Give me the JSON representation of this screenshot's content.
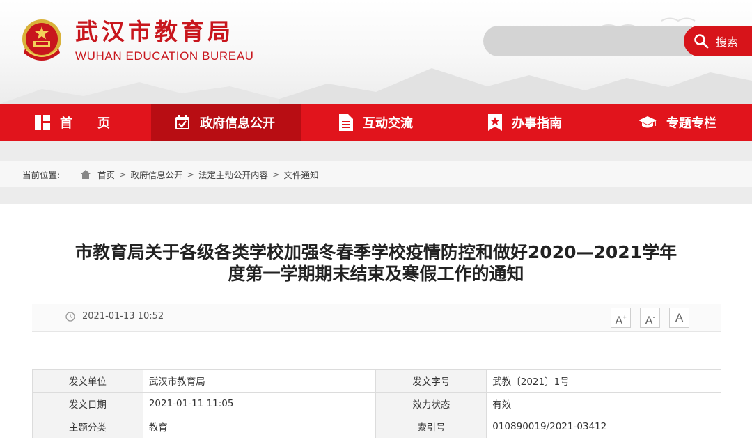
{
  "site": {
    "title": "武汉市教育局",
    "subtitle": "WUHAN EDUCATION BUREAU"
  },
  "search": {
    "placeholder": "",
    "button_label": "搜索"
  },
  "nav": [
    {
      "label": "首　　页",
      "icon": "home-grid-icon",
      "active": false
    },
    {
      "label": "政府信息公开",
      "icon": "calendar-check-icon",
      "active": true
    },
    {
      "label": "互动交流",
      "icon": "document-icon",
      "active": false
    },
    {
      "label": "办事指南",
      "icon": "bookmark-star-icon",
      "active": false
    },
    {
      "label": "专题专栏",
      "icon": "graduation-cap-icon",
      "active": false
    }
  ],
  "breadcrumb": {
    "label": "当前位置:",
    "items": [
      "首页",
      "政府信息公开",
      "法定主动公开内容",
      "文件通知"
    ],
    "separator": ">"
  },
  "article": {
    "title_line1": "市教育局关于各级各类学校加强冬春季学校疫情防控和做好2020—2021学年",
    "title_line2": "度第一学期期末结束及寒假工作的通知",
    "date": "2021-01-13 10:52",
    "font_buttons": [
      "A+",
      "A-",
      "A"
    ]
  },
  "info_table": [
    {
      "k1": "发文单位",
      "v1": "武汉市教育局",
      "k2": "发文字号",
      "v2": "武教〔2021〕1号"
    },
    {
      "k1": "发文日期",
      "v1": "2021-01-11 11:05",
      "k2": "效力状态",
      "v2": "有效"
    },
    {
      "k1": "主题分类",
      "v1": "教育",
      "k2": "索引号",
      "v2": "010890019/2021-03412"
    }
  ],
  "colors": {
    "brand_red": "#e1141c",
    "nav_active": "#b80d13",
    "title_red": "#c8161d"
  }
}
